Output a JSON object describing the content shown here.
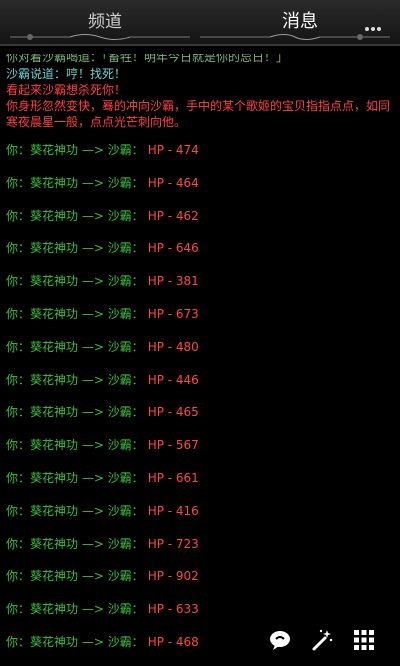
{
  "tabs": {
    "channel": "频道",
    "message": "消息"
  },
  "log": {
    "partial_line": "你对着沙霸喝道：「畜牲！明年今日就是你的忌日！」",
    "shaba_says": "沙霸说道：哼！找死！",
    "kill_intent": "看起来沙霸想杀死你！",
    "story": "你身形忽然变快，蓦的冲向沙霸，手中的某个歌姬的宝贝指指点点，如同寒夜晨星一般，点点光芒刺向他。"
  },
  "combat": [
    {
      "action": "你：葵花神功 —> 沙霸：",
      "hp": "HP - 474"
    },
    {
      "action": "你：葵花神功 —> 沙霸：",
      "hp": "HP - 464"
    },
    {
      "action": "你：葵花神功 —> 沙霸：",
      "hp": "HP - 462"
    },
    {
      "action": "你：葵花神功 —> 沙霸：",
      "hp": "HP - 646"
    },
    {
      "action": "你：葵花神功 —> 沙霸：",
      "hp": "HP - 381"
    },
    {
      "action": "你：葵花神功 —> 沙霸：",
      "hp": "HP - 673"
    },
    {
      "action": "你：葵花神功 —> 沙霸：",
      "hp": "HP - 480"
    },
    {
      "action": "你：葵花神功 —> 沙霸：",
      "hp": "HP - 446"
    },
    {
      "action": "你：葵花神功 —> 沙霸：",
      "hp": "HP - 465"
    },
    {
      "action": "你：葵花神功 —> 沙霸：",
      "hp": "HP - 567"
    },
    {
      "action": "你：葵花神功 —> 沙霸：",
      "hp": "HP - 661"
    },
    {
      "action": "你：葵花神功 —> 沙霸：",
      "hp": "HP - 416"
    },
    {
      "action": "你：葵花神功 —> 沙霸：",
      "hp": "HP - 723"
    },
    {
      "action": "你：葵花神功 —> 沙霸：",
      "hp": "HP - 902"
    },
    {
      "action": "你：葵花神功 —> 沙霸：",
      "hp": "HP - 633"
    },
    {
      "action": "你：葵花神功 —> 沙霸：",
      "hp": "HP - 468"
    }
  ],
  "icons": {
    "more": "more-icon",
    "chat": "chat-bubble-icon",
    "wand": "magic-wand-icon",
    "grid": "grid-menu-icon"
  },
  "colors": {
    "background": "#000000",
    "combat_action": "#39c239",
    "combat_hp": "#ff4a3a",
    "shaba_text": "#6fd0d0",
    "warning_text": "#ff4040"
  }
}
